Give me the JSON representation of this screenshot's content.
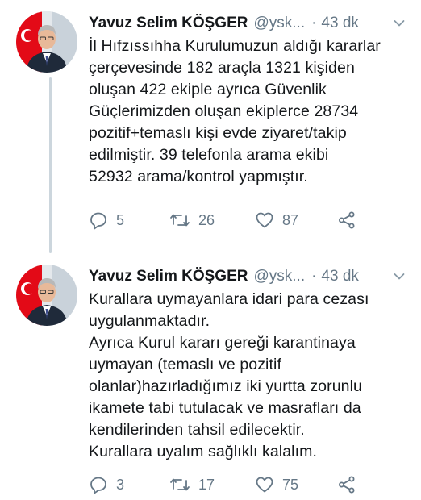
{
  "tweets": [
    {
      "author": {
        "name": "Yavuz Selim KÖŞGER",
        "handle": "@ysk...",
        "avatar_icon": "profile-photo"
      },
      "separator": "·",
      "time": "43 dk",
      "text_lines": [
        "İl Hıfzıssıhha Kurulumuzun aldığı kararlar",
        "çerçevesinde 182 araçla 1321 kişiden",
        "oluşan 422 ekiple ayrıca Güvenlik",
        "Güçlerimizden oluşan ekiplerce 28734",
        "pozitif+temaslı kişi evde ziyaret/takip",
        "edilmiştir. 39 telefonla arama ekibi",
        "52932 arama/kontrol yapmıştır."
      ],
      "actions": {
        "replies": "5",
        "retweets": "26",
        "likes": "87"
      }
    },
    {
      "author": {
        "name": "Yavuz Selim KÖŞGER",
        "handle": "@ysk...",
        "avatar_icon": "profile-photo"
      },
      "separator": "·",
      "time": "43 dk",
      "text_lines": [
        "Kurallara uymayanlara idari para cezası",
        "uygulanmaktadır.",
        "Ayrıca Kurul kararı gereği karantinaya",
        "uymayan (temaslı ve pozitif",
        "olanlar)hazırladığımız iki yurtta zorunlu",
        "ikamete tabi tutulacak ve masrafları da",
        "kendilerinden tahsil edilecektir.",
        "Kurallara uyalım sağlıklı kalalım."
      ],
      "actions": {
        "replies": "3",
        "retweets": "17",
        "likes": "75"
      }
    }
  ],
  "colors": {
    "text": "#14171a",
    "secondary": "#657786",
    "thread_line": "#ccd6dd",
    "flag_red": "#e30a17"
  },
  "icons": [
    "reply-icon",
    "retweet-icon",
    "like-icon",
    "share-icon",
    "chevron-down-icon"
  ]
}
